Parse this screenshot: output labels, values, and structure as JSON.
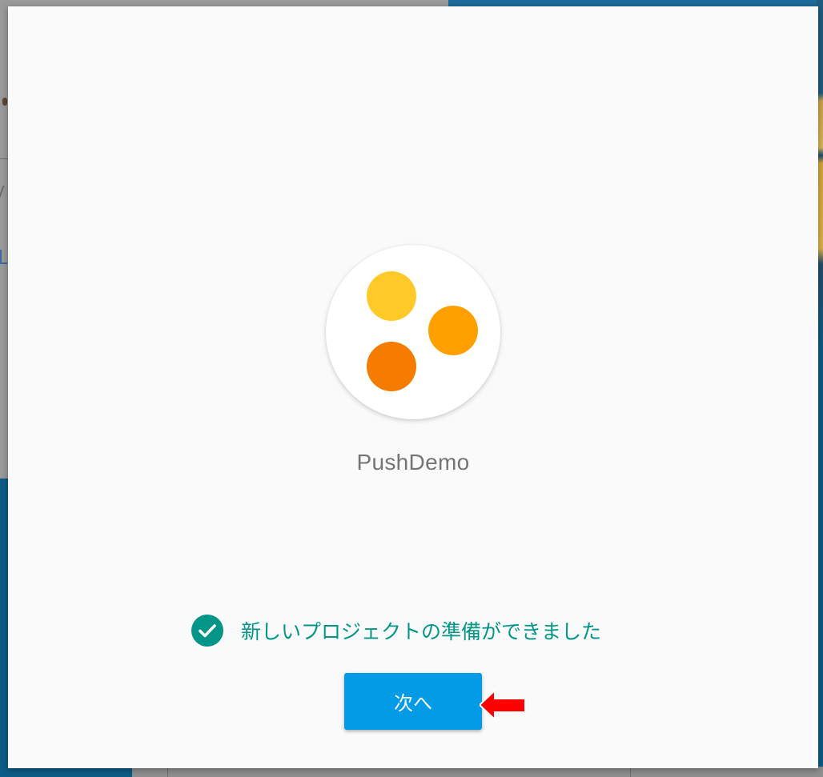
{
  "dialog": {
    "project_name": "PushDemo",
    "status_message": "新しいプロジェクトの準備ができました",
    "next_button_label": "次へ"
  },
  "logo": {
    "dots": [
      {
        "name": "yellow",
        "color": "#ffca28"
      },
      {
        "name": "orange",
        "color": "#ffa000"
      },
      {
        "name": "dark-orange",
        "color": "#f57c00"
      }
    ]
  },
  "icons": {
    "status": "check-circle-icon",
    "annotation": "red-arrow-icon"
  },
  "colors": {
    "accent_teal": "#039588",
    "button_blue": "#039be5",
    "annotation_red": "#ff0000"
  }
}
